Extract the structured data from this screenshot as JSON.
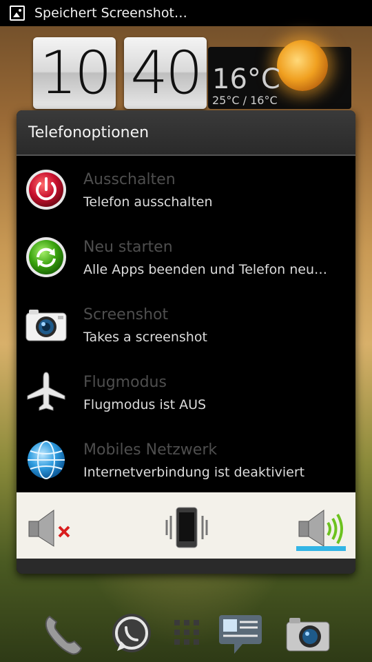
{
  "status_bar": {
    "icon": "screenshot-image-icon",
    "text": "Speichert Screenshot…"
  },
  "clock": {
    "hour": "10",
    "minute": "40"
  },
  "weather": {
    "current": "16°C",
    "range": "25°C / 16°C",
    "icon": "sun-icon"
  },
  "dialog": {
    "title": "Telefonoptionen",
    "options": [
      {
        "title": "Ausschalten",
        "subtitle": "Telefon ausschalten",
        "icon": "power-icon"
      },
      {
        "title": "Neu starten",
        "subtitle": "Alle Apps beenden und Telefon neu…",
        "icon": "restart-icon"
      },
      {
        "title": "Screenshot",
        "subtitle": "Takes a screenshot",
        "icon": "camera-icon"
      },
      {
        "title": "Flugmodus",
        "subtitle": "Flugmodus ist AUS",
        "icon": "airplane-icon"
      },
      {
        "title": "Mobiles Netzwerk",
        "subtitle": "Internetverbindung ist deaktiviert",
        "icon": "globe-icon"
      }
    ],
    "sound_modes": [
      "mute-icon",
      "vibrate-icon",
      "sound-on-icon"
    ],
    "selected_sound_mode": "sound-on"
  },
  "dock": [
    "phone-icon",
    "whatsapp-icon",
    "app-drawer-icon",
    "messages-icon",
    "camera-icon"
  ],
  "colors": {
    "accent": "#33b5e5",
    "dialog_bg": "#000000",
    "title_text": "#4e4e4e",
    "subtitle_text": "#dcdcdc"
  }
}
